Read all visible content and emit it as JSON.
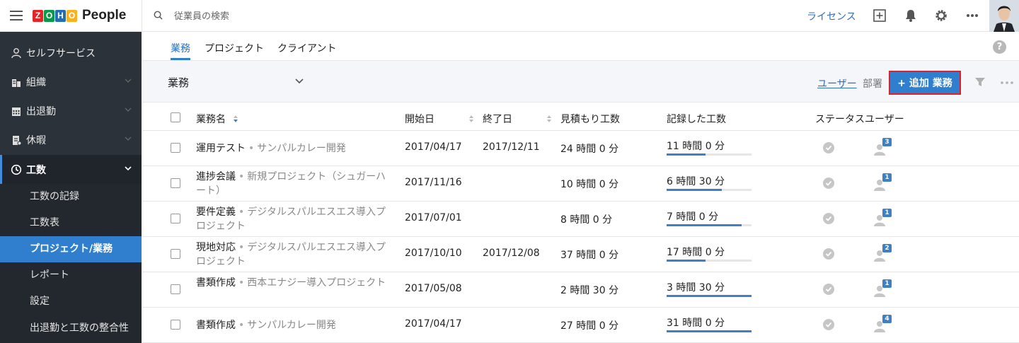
{
  "app": {
    "logo_letters": [
      "Z",
      "O",
      "H",
      "O"
    ],
    "logo_colors": [
      "#e42527",
      "#089949",
      "#226db4",
      "#f9b21d"
    ],
    "product_name": "People"
  },
  "topbar": {
    "search_placeholder": "従業員の検索",
    "license_label": "ライセンス",
    "icons": [
      "add-square-icon",
      "bell-icon",
      "gear-icon",
      "more-icon"
    ]
  },
  "sidebar": {
    "items": [
      {
        "label": "セルフサービス",
        "icon": "user-icon"
      },
      {
        "label": "組織",
        "icon": "building-icon"
      },
      {
        "label": "出退勤",
        "icon": "calendar-icon"
      },
      {
        "label": "休暇",
        "icon": "leave-icon"
      },
      {
        "label": "工数",
        "icon": "clock-icon"
      }
    ],
    "subitems": [
      {
        "label": "工数の記録"
      },
      {
        "label": "工数表"
      },
      {
        "label": "プロジェクト/業務"
      },
      {
        "label": "レポート"
      },
      {
        "label": "設定"
      },
      {
        "label": "出退勤と工数の整合性"
      }
    ]
  },
  "tabs": [
    "業務",
    "プロジェクト",
    "クライアント"
  ],
  "toolbar": {
    "view_title": "業務",
    "users_label": "ユーザー",
    "dept_label": "部署",
    "add_label": "+ 追加 業務"
  },
  "table": {
    "headers": [
      "業務名",
      "開始日",
      "終了日",
      "見積もり工数",
      "記録した工数",
      "ステータス",
      "ユーザー"
    ],
    "rows": [
      {
        "task": "運用テスト",
        "project": "サンパルカレー開発",
        "start": "2017/04/17",
        "end": "2017/12/11",
        "estimate": "24 時間 0 分",
        "logged": "11 時間 0 分",
        "progress": 0.46,
        "users": "3"
      },
      {
        "task": "進捗会議",
        "project": "新規プロジェクト（シュガーハート）",
        "start": "2017/11/16",
        "end": "",
        "estimate": "10 時間 0 分",
        "logged": "6 時間 30 分",
        "progress": 0.65,
        "users": "1"
      },
      {
        "task": "要件定義",
        "project": "デジタルスパルエスエス導入プロジェクト",
        "start": "2017/07/01",
        "end": "",
        "estimate": "8 時間 0 分",
        "logged": "7 時間 0 分",
        "progress": 0.88,
        "users": "1"
      },
      {
        "task": "現地対応",
        "project": "デジタルスパルエスエス導入プロジェクト",
        "start": "2017/10/10",
        "end": "2017/12/08",
        "estimate": "37 時間 0 分",
        "logged": "17 時間 0 分",
        "progress": 0.46,
        "users": "2"
      },
      {
        "task": "書類作成",
        "project": "西本エナジー導入プロジェクト",
        "start": "2017/05/08",
        "end": "",
        "estimate": "2 時間 30 分",
        "logged": "3 時間 30 分",
        "progress": 1.0,
        "users": "1"
      },
      {
        "task": "書類作成",
        "project": "サンパルカレー開発",
        "start": "2017/04/17",
        "end": "",
        "estimate": "27 時間 0 分",
        "logged": "31 時間 0 分",
        "progress": 1.0,
        "users": "4"
      }
    ]
  }
}
